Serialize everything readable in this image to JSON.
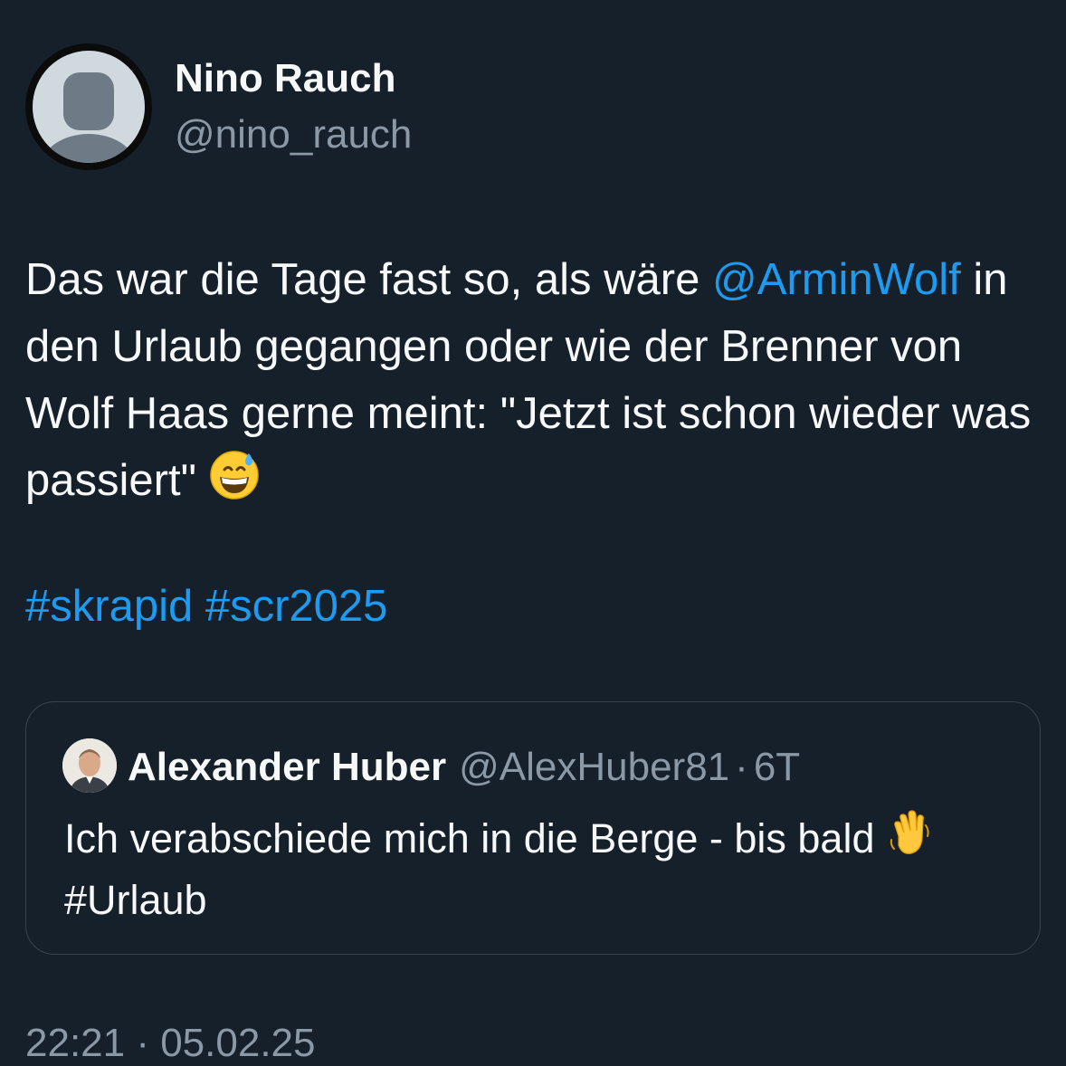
{
  "author": {
    "name": "Nino Rauch",
    "handle": "@nino_rauch",
    "avatar_icon": "default-profile-icon"
  },
  "tweet": {
    "text_part1": "Das war die Tage fast so, als wäre ",
    "mention": "@ArminWolf",
    "text_part2": " in den Urlaub gegangen oder wie der Brenner von Wolf Haas gerne meint: \"Jetzt ist schon wieder was passiert\" ",
    "emoji_icon": "grinning-face-with-sweat-emoji",
    "hashtag1": "#skrapid",
    "hashtag2": "#scr2025"
  },
  "quoted_tweet": {
    "author_name": "Alexander Huber",
    "author_handle": "@AlexHuber81",
    "separator": "·",
    "time": "6T",
    "text": "Ich verabschiede mich in die Berge - bis bald ",
    "emoji_icon": "waving-hand-emoji",
    "hashtag": "#Urlaub"
  },
  "timestamp": "22:21 · 05.02.25",
  "colors": {
    "background": "#15202b",
    "text": "#f7f9f9",
    "secondary_text": "#8b98a5",
    "link": "#1d9bf0",
    "border": "#38444d"
  }
}
